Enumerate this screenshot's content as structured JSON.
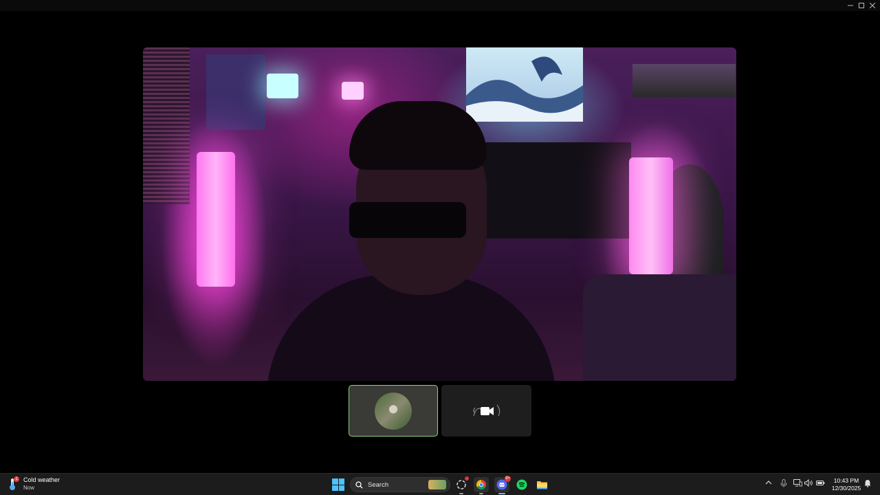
{
  "window": {
    "controls": [
      "minimize-icon",
      "maximize-icon",
      "close-icon"
    ]
  },
  "call": {
    "main_video": "camera-feed",
    "thumbnails": [
      {
        "kind": "self-avatar",
        "selected": true
      },
      {
        "kind": "camera-icon",
        "selected": false
      }
    ]
  },
  "taskbar": {
    "weather": {
      "title": "Cold weather",
      "subtitle": "Now",
      "badge": "1"
    },
    "search": {
      "label": "Search"
    },
    "apps": [
      {
        "name": "ai-app-icon",
        "badge": ""
      },
      {
        "name": "chrome-icon",
        "badge": ""
      },
      {
        "name": "discord-icon",
        "badge": "9+"
      },
      {
        "name": "spotify-icon",
        "badge": ""
      },
      {
        "name": "file-explorer-icon",
        "badge": ""
      }
    ],
    "clock": {
      "time": "10:43 PM",
      "date": "12/30/2025"
    }
  },
  "colors": {
    "accent": "#4cc2ff",
    "selected_border": "#8fd47f",
    "badge_red": "#d83a3a",
    "spotify": "#1ed760",
    "discord": "#5865f2"
  }
}
